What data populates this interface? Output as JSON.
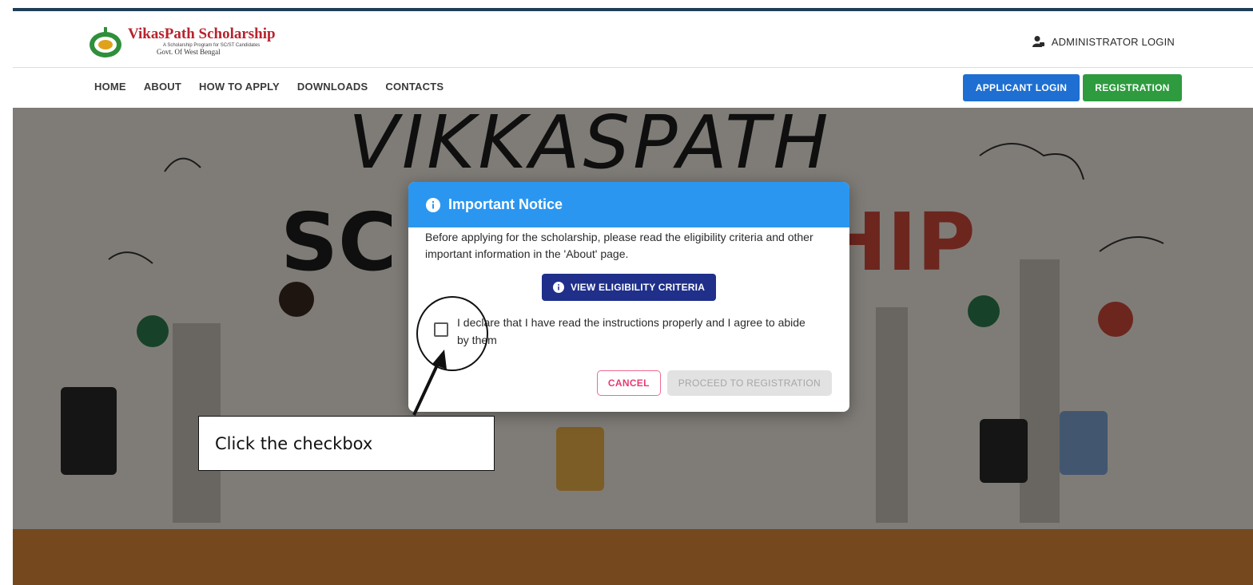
{
  "header": {
    "brand_title": "VikasPath Scholarship",
    "brand_tagline": "A Scholarship Program for SC/ST Candidates",
    "brand_subtitle": "Govt. Of West Bengal",
    "admin_login_label": "ADMINISTRATOR LOGIN",
    "admin_icon": "user-lock-icon"
  },
  "nav": {
    "items": [
      {
        "label": "HOME"
      },
      {
        "label": "ABOUT"
      },
      {
        "label": "HOW TO APPLY"
      },
      {
        "label": "DOWNLOADS"
      },
      {
        "label": "CONTACTS"
      }
    ],
    "applicant_login_label": "APPLICANT LOGIN",
    "registration_label": "REGISTRATION"
  },
  "hero": {
    "line1": "VIKKASPATH",
    "line2_left": "SC",
    "line2_right": "HIP"
  },
  "modal": {
    "title": "Important Notice",
    "body": "Before applying for the scholarship, please read the eligibility criteria and other important information in the 'About' page.",
    "criteria_button": "VIEW ELIGIBILITY CRITERIA",
    "declaration": "I declare that I have read the instructions properly and I agree to abide by them",
    "declaration_checked": false,
    "cancel_button": "CANCEL",
    "proceed_button": "PROCEED TO REGISTRATION"
  },
  "annotation": {
    "callout_text": "Click the checkbox"
  },
  "colors": {
    "modal_header": "#2b96f0",
    "criteria_button": "#1f2f8a",
    "applicant_login": "#1e6fd1",
    "registration": "#2e9b3f",
    "cancel_accent": "#e63b72",
    "brand_red": "#b8232e"
  }
}
